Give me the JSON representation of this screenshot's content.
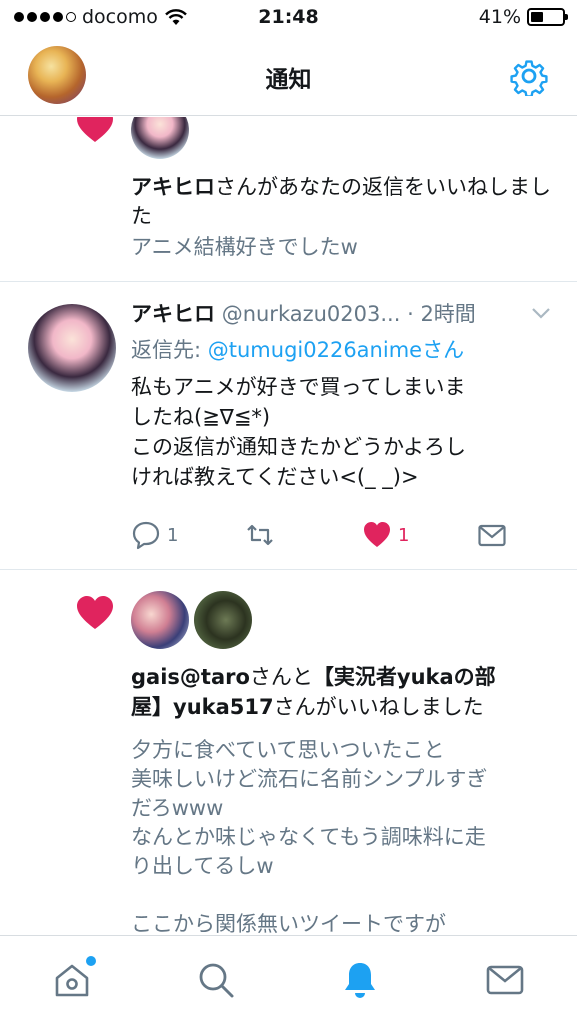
{
  "status_bar": {
    "carrier": "docomo",
    "time": "21:48",
    "battery": "41%",
    "battery_level": 0.41
  },
  "header": {
    "title": "通知",
    "settings_icon": "gear-icon"
  },
  "notifications": [
    {
      "type": "like",
      "actor_name": "アキヒロ",
      "action_text": "さんがあなたの返信をいいねしました",
      "tweet_text": "アニメ結構好きでしたw"
    },
    {
      "type": "reply",
      "name": "アキヒロ",
      "handle": "@nurkazu0203...",
      "time": "· 2時間",
      "reply_label": "返信先: ",
      "reply_to": "@tumugi0226animeさん",
      "body_lines": [
        "私もアニメが好きで買ってしまいま",
        "したね(≧∇≦*)",
        "この返信が通知きたかどうかよろし",
        "ければ教えてください<(_ _)>"
      ],
      "reply_count": "1",
      "like_count": "1"
    },
    {
      "type": "like",
      "actor1": "gais@taro",
      "joiner": "さんと",
      "actor2_line1": "【実況者yukaの部",
      "actor2_line2": "屋】yuka517",
      "action_text": "さんがいいねしました",
      "tweet_lines": [
        "夕方に食べていて思いついたこと",
        "美味しいけど流石に名前シンプルすぎ",
        "だろwww",
        "なんとか味じゃなくてもう調味料に走",
        "り出してるしw",
        "",
        "ここから関係無いツイートですが"
      ]
    }
  ],
  "tab_bar": {
    "items": [
      "home-icon",
      "search-icon",
      "notifications-icon",
      "messages-icon"
    ],
    "active": "notifications-icon"
  },
  "colors": {
    "accent": "#1da1f2",
    "like": "#e0245e",
    "muted": "#657786"
  }
}
